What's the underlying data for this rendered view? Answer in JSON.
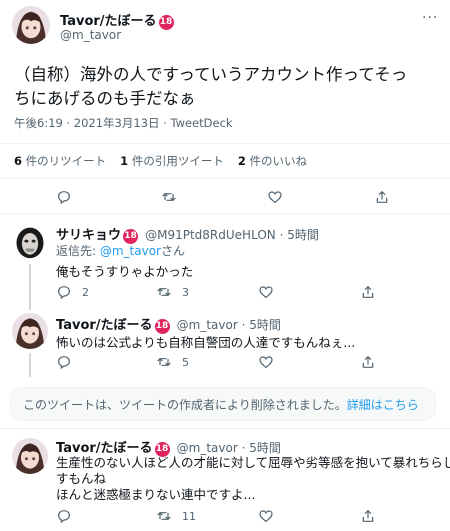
{
  "main_tweet": {
    "author_name": "Tavor/たぼーる",
    "badge": "18",
    "handle": "@m_tavor",
    "text_line1": "（自称）海外の人ですっていうアカウント作ってそっ",
    "text_line2": "ちにあげるのも手だなぁ",
    "timestamp": "午後6:19 · 2021年3月13日 · TweetDeck",
    "stats": {
      "retweets_count": "6",
      "retweets_label": "件のリツイート",
      "quotes_count": "1",
      "quotes_label": "件の引用ツイート",
      "likes_count": "2",
      "likes_label": "件のいいね"
    }
  },
  "replies": [
    {
      "author_name": "サリキョウ",
      "badge": "18",
      "handle_time": "@M91Ptd8RdUeHLON · 5時間",
      "reply_to_prefix": "返信先: ",
      "reply_to_handle": "@m_tavor",
      "reply_to_suffix": "さん",
      "text": "俺もそうすりゃよかった",
      "reply_count": "2",
      "retweet_count": "3"
    },
    {
      "author_name": "Tavor/たぼーる",
      "badge": "18",
      "handle_time": "@m_tavor · 5時間",
      "text": "怖いのは公式よりも自称自警団の人達ですもんねぇ...",
      "retweet_count": "5"
    },
    {
      "author_name": "Tavor/たぼーる",
      "badge": "18",
      "handle_time": "@m_tavor · 5時間",
      "text_line1": "生産性のない人ほど人の才能に対して屈辱や劣等感を抱いて暴れちらしま",
      "text_line2": "すもんね",
      "text_line3": "ほんと迷惑極まりない連中ですよ...",
      "retweet_count": "11"
    }
  ],
  "deleted_notice": {
    "text": "このツイートは、ツイートの作成者により削除されました。",
    "link": "詳細はこちら"
  },
  "colors": {
    "accent": "#1d9bf0",
    "badge": "#e0245e",
    "muted": "#536471"
  }
}
